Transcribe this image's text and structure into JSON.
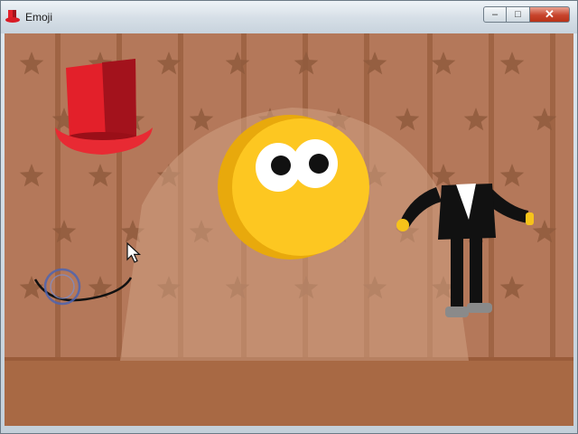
{
  "window": {
    "title": "Emoji",
    "icon": "red-top-hat-icon",
    "controls": {
      "minimize_icon": "minimize-icon",
      "maximize_icon": "maximize-icon",
      "close_icon": "close-icon",
      "minimize_glyph": "–",
      "maximize_glyph": "□",
      "close_glyph": "✕"
    }
  },
  "stage": {
    "wall_color": "#b4785a",
    "stripe_color": "#8e5433",
    "star_color": "#8f5a3d",
    "floor_color": "#a86944",
    "spotlight_color": "#d0a083",
    "star_columns": 8,
    "star_rows": 5
  },
  "sprites": {
    "top_hat": {
      "icon": "red-top-hat",
      "color": "#e3202a",
      "shade": "#a3121c"
    },
    "emoji_face": {
      "icon": "yellow-smiley-face",
      "color": "#fdc721",
      "shade": "#e8a90c"
    },
    "tuxedo_body": {
      "icon": "tuxedo-body",
      "color": "#111111",
      "shirt": "#ffffff",
      "hands": "#f6c31a",
      "shoes": "#8a8a8a"
    },
    "mouth": {
      "icon": "smile-mouth-curve",
      "color": "#111111"
    }
  },
  "cursor": {
    "icon": "mouse-pointer-icon"
  },
  "drag_indicator": {
    "icon": "drag-target-ring-icon",
    "color": "#4d64b0"
  }
}
